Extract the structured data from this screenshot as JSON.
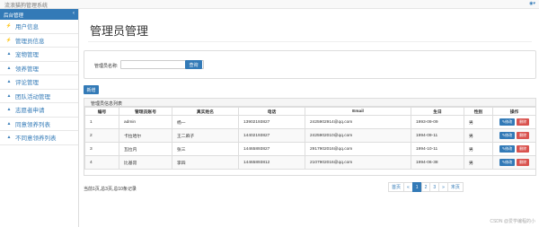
{
  "app": {
    "title": "流浪猫狗管理系统",
    "user_icon": "user-icon"
  },
  "sidebar": {
    "header": "后台管理",
    "items": [
      {
        "label": "用户信息",
        "icon": "bolt-icon"
      },
      {
        "label": "管理员信息",
        "icon": "bolt-icon"
      },
      {
        "label": "宠物管理",
        "icon": "network-icon"
      },
      {
        "label": "领养管理",
        "icon": "network-icon"
      },
      {
        "label": "评论管理",
        "icon": "network-icon"
      },
      {
        "label": "团队活动管理",
        "icon": "network-icon"
      },
      {
        "label": "志愿者申请",
        "icon": "network-icon"
      },
      {
        "label": "同意领养列表",
        "icon": "network-icon"
      },
      {
        "label": "不同意领养列表",
        "icon": "network-icon"
      }
    ]
  },
  "main": {
    "page_title": "管理员管理",
    "search": {
      "label": "管理员名称:",
      "value": "",
      "button": "查询"
    },
    "add_button": "新增",
    "table": {
      "heading": "管理员信息列表",
      "columns": [
        "编号",
        "管理员账号",
        "真实姓名",
        "电话",
        "Email",
        "生日",
        "性别",
        "操作"
      ],
      "rows": [
        [
          "1",
          "admin",
          "杨一",
          "13902193827",
          "2425902914@qq.com",
          "1993-09-09",
          "男"
        ],
        [
          "2",
          "卡拉哈尔",
          "王二麻子",
          "14402193827",
          "2425902010@qq.com",
          "1994-09-11",
          "男"
        ],
        [
          "3",
          "瓦拉内",
          "张三",
          "14465893827",
          "2917902016@qq.com",
          "1994-10-11",
          "男"
        ],
        [
          "4",
          "比基昂",
          "李四",
          "14465893812",
          "2107902016@qq.com",
          "1994-06-38",
          "男"
        ]
      ],
      "edit_label": "修改",
      "delete_label": "删除"
    },
    "footer_info": "当前1页,总3页,总10条记录",
    "pagination": [
      "首页",
      "«",
      "1",
      "2",
      "3",
      "»",
      "末页"
    ],
    "current_page": "1"
  },
  "watermark": "CSDN @爱学编程的小",
  "colors": {
    "primary": "#337ab7",
    "danger": "#d9534f",
    "header_bg": "#f8f8f8"
  }
}
